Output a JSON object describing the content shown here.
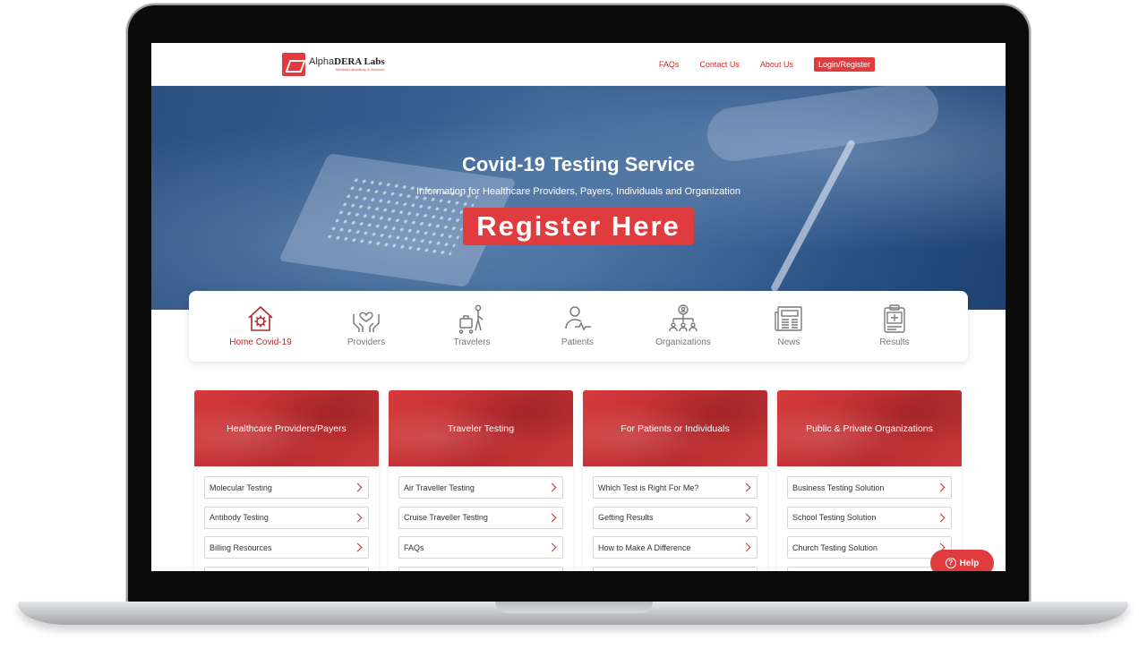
{
  "brand": {
    "name_light": "Alpha",
    "name_bold": "DERA Labs",
    "tagline": "Medical Laboratory & Services"
  },
  "nav": {
    "items": [
      "FAQs",
      "Contact Us",
      "About Us"
    ],
    "login": "Login/Register"
  },
  "hero": {
    "title": "Covid-19 Testing Service",
    "subtitle": "Information for Healthcare Providers, Payers, Individuals and Organization",
    "cta": "Register Here"
  },
  "categories": [
    {
      "label": "Home Covid-19",
      "icon": "home-virus-icon",
      "active": true
    },
    {
      "label": "Providers",
      "icon": "hands-heart-icon",
      "active": false
    },
    {
      "label": "Travelers",
      "icon": "traveler-luggage-icon",
      "active": false
    },
    {
      "label": "Patients",
      "icon": "patient-pulse-icon",
      "active": false
    },
    {
      "label": "Organizations",
      "icon": "organization-icon",
      "active": false
    },
    {
      "label": "News",
      "icon": "newspaper-icon",
      "active": false
    },
    {
      "label": "Results",
      "icon": "clipboard-medical-icon",
      "active": false
    }
  ],
  "cards": [
    {
      "title": "Healthcare Providers/Payers",
      "links": [
        "Molecular Testing",
        "Antibody Testing",
        "Billing Resources",
        ""
      ]
    },
    {
      "title": "Traveler Testing",
      "links": [
        "Air Traveller Testing",
        "Cruise Traveller Testing",
        "FAQs",
        ""
      ]
    },
    {
      "title": "For Patients or Individuals",
      "links": [
        "Which Test is Right For Me?",
        "Getting Results",
        "How to Make A Difference",
        ""
      ]
    },
    {
      "title": "Public & Private Organizations",
      "links": [
        "Business Testing Solution",
        "School Testing Solution",
        "Church Testing Solution",
        ""
      ]
    }
  ],
  "help": {
    "label": "Help",
    "icon": "question-circle-icon"
  },
  "colors": {
    "accent": "#e03b3f",
    "hero": "#2c5080",
    "laptop": "#0b0b0c"
  }
}
